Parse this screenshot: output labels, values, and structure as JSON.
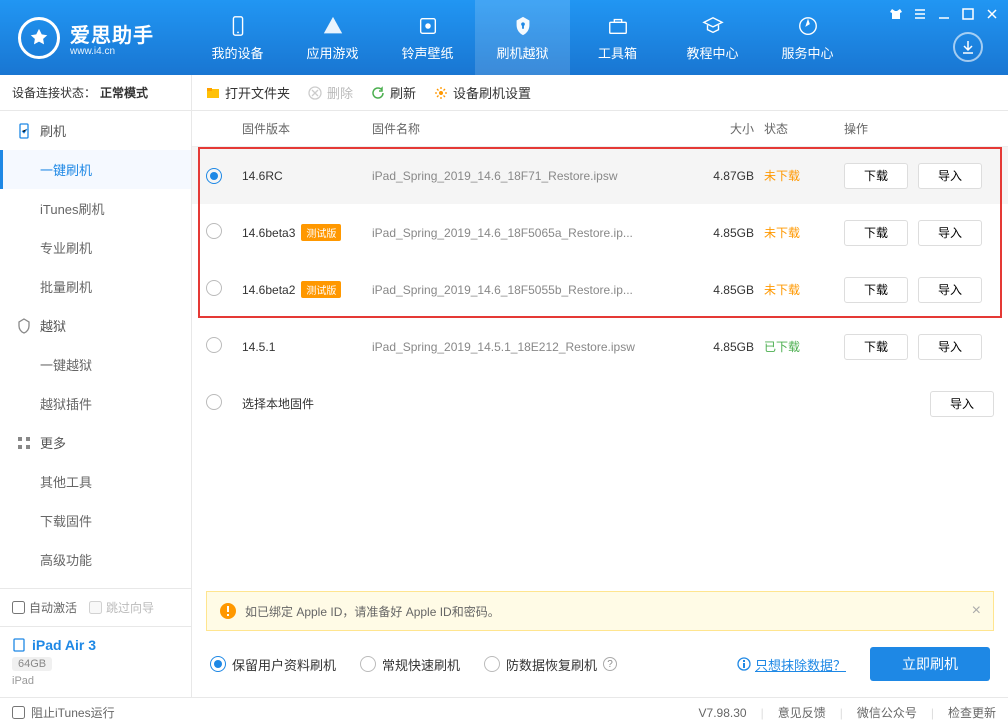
{
  "app": {
    "name_cn": "爱思助手",
    "name_en": "www.i4.cn"
  },
  "nav": [
    "我的设备",
    "应用游戏",
    "铃声壁纸",
    "刷机越狱",
    "工具箱",
    "教程中心",
    "服务中心"
  ],
  "status": {
    "label": "设备连接状态：",
    "mode": "正常模式"
  },
  "sidebar": {
    "groups": [
      {
        "label": "刷机",
        "items": [
          "一键刷机",
          "iTunes刷机",
          "专业刷机",
          "批量刷机"
        ]
      },
      {
        "label": "越狱",
        "items": [
          "一键越狱",
          "越狱插件"
        ]
      },
      {
        "label": "更多",
        "items": [
          "其他工具",
          "下载固件",
          "高级功能"
        ]
      }
    ],
    "checks": {
      "auto": "自动激活",
      "skip": "跳过向导"
    },
    "device": {
      "name": "iPad Air 3",
      "storage": "64GB",
      "type": "iPad"
    }
  },
  "toolbar": {
    "open": "打开文件夹",
    "delete": "删除",
    "refresh": "刷新",
    "settings": "设备刷机设置"
  },
  "thead": {
    "ver": "固件版本",
    "name": "固件名称",
    "size": "大小",
    "status": "状态",
    "ops": "操作"
  },
  "badge": "测试版",
  "firmware": [
    {
      "ver": "14.6RC",
      "beta": false,
      "name": "iPad_Spring_2019_14.6_18F71_Restore.ipsw",
      "size": "4.87GB",
      "status": "未下载",
      "stClass": "status-orange",
      "sel": true,
      "dl": true
    },
    {
      "ver": "14.6beta3",
      "beta": true,
      "name": "iPad_Spring_2019_14.6_18F5065a_Restore.ip...",
      "size": "4.85GB",
      "status": "未下载",
      "stClass": "status-orange",
      "sel": false,
      "dl": true
    },
    {
      "ver": "14.6beta2",
      "beta": true,
      "name": "iPad_Spring_2019_14.6_18F5055b_Restore.ip...",
      "size": "4.85GB",
      "status": "未下载",
      "stClass": "status-orange",
      "sel": false,
      "dl": true
    },
    {
      "ver": "14.5.1",
      "beta": false,
      "name": "iPad_Spring_2019_14.5.1_18E212_Restore.ipsw",
      "size": "4.85GB",
      "status": "已下载",
      "stClass": "status-green",
      "sel": false,
      "dl": true
    }
  ],
  "local_fw": "选择本地固件",
  "buttons": {
    "download": "下载",
    "import": "导入"
  },
  "notice": "如已绑定 Apple ID，请准备好 Apple ID和密码。",
  "flash_opts": {
    "keep": "保留用户资料刷机",
    "normal": "常规快速刷机",
    "anti": "防数据恢复刷机",
    "erase": "只想抹除数据？",
    "go": "立即刷机"
  },
  "footer": {
    "stop": "阻止iTunes运行",
    "ver": "V7.98.30",
    "feedback": "意见反馈",
    "wechat": "微信公众号",
    "update": "检查更新"
  }
}
